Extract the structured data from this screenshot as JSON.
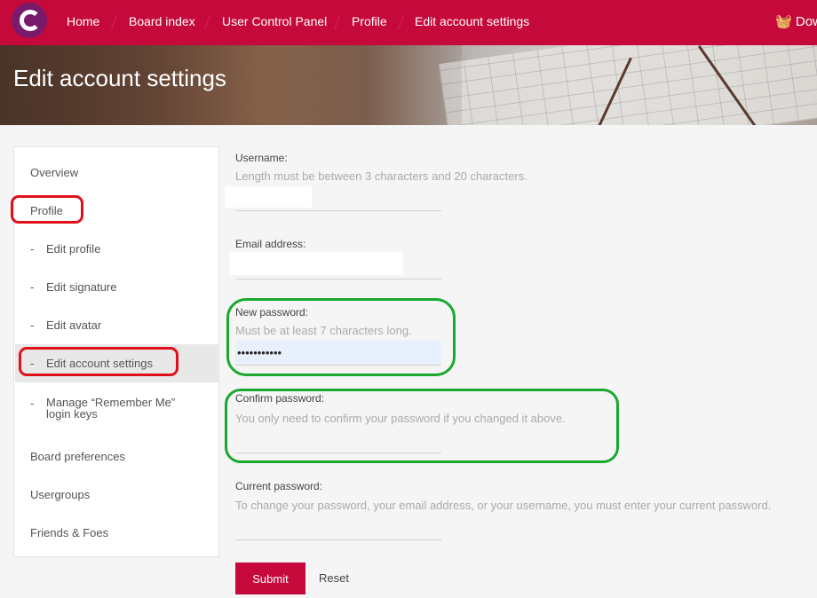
{
  "nav": {
    "items": [
      "Home",
      "Board index",
      "User Control Panel",
      "Profile",
      "Edit account settings"
    ],
    "right_label": "Dow",
    "logo_icon": "c-logo-icon",
    "basket_icon": "basket-icon",
    "bar_color": "#c6093b"
  },
  "banner": {
    "title": "Edit account settings"
  },
  "sidebar": {
    "overview": "Overview",
    "profile": "Profile",
    "sub_items": [
      "Edit profile",
      "Edit signature",
      "Edit avatar",
      "Edit account settings"
    ],
    "remember_line1": "Manage “Remember Me”",
    "remember_line2": "login keys",
    "dash": "-",
    "board_preferences": "Board preferences",
    "usergroups": "Usergroups",
    "friends_foes": "Friends & Foes"
  },
  "form": {
    "username_label": "Username:",
    "username_help": "Length must be between 3 characters and 20 characters.",
    "email_label": "Email address:",
    "new_password_label": "New password:",
    "new_password_help": "Must be at least 7 characters long.",
    "new_password_value": "•••••••••••",
    "confirm_password_label": "Confirm password:",
    "confirm_password_help": "You only need to confirm your password if you changed it above.",
    "current_password_label": "Current password:",
    "current_password_help": "To change your password, your email address, or your username, you must enter your current password.",
    "submit_label": "Submit",
    "reset_label": "Reset"
  },
  "annotations": {
    "red": "#e0101a",
    "green": "#1aa82e"
  }
}
